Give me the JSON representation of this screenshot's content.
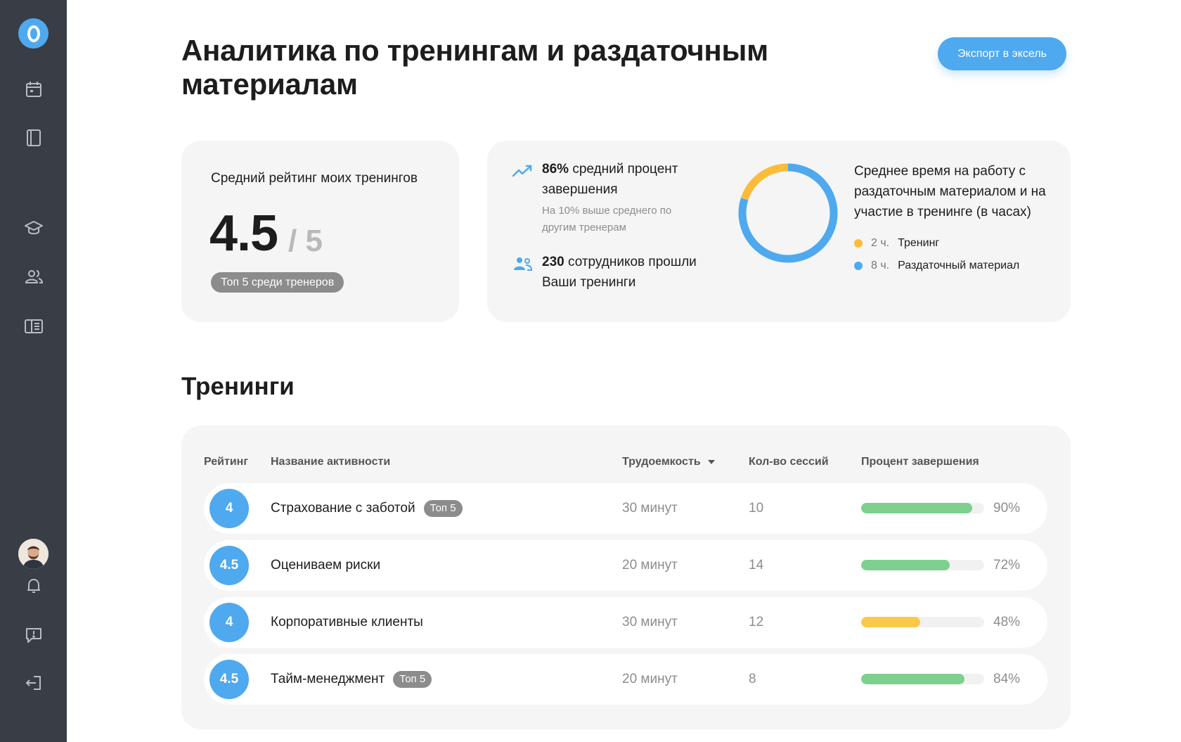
{
  "header": {
    "title": "Аналитика по тренингам и раздаточным материалам",
    "export_label": "Экспорт в эксель"
  },
  "rating_card": {
    "label": "Средний рейтинг моих тренингов",
    "value": "4.5",
    "max": "/ 5",
    "badge": "Топ 5 среди тренеров"
  },
  "completion_stat": {
    "value": "86%",
    "text": "средний процент завершения",
    "sub": "На 10% выше среднего по другим тренерам"
  },
  "employees_stat": {
    "value": "230",
    "text": "сотрудников прошли Ваши тренинги"
  },
  "time_chart": {
    "title": "Среднее время на работу с раздаточным материалом и на участие в тренинге (в часах)",
    "items": [
      {
        "value": "2 ч.",
        "label": "Тренинг",
        "hours": 2,
        "color": "#fbbc3c"
      },
      {
        "value": "8 ч.",
        "label": "Раздаточный материал",
        "hours": 8,
        "color": "#4ea9ef"
      }
    ]
  },
  "trainings": {
    "title": "Тренинги",
    "columns": {
      "rating": "Рейтинг",
      "name": "Название активности",
      "effort": "Трудоемкость",
      "sessions": "Кол-во сессий",
      "completion": "Процент завершения"
    },
    "rows": [
      {
        "rating": "4",
        "name": "Страхование с заботой",
        "badge": "Топ 5",
        "effort": "30 минут",
        "sessions": "10",
        "percent_label": "90%",
        "percent": 90,
        "color": "#7fcf8f"
      },
      {
        "rating": "4.5",
        "name": "Оцениваем риски",
        "badge": "",
        "effort": "20 минут",
        "sessions": "14",
        "percent_label": "72%",
        "percent": 72,
        "color": "#7fcf8f"
      },
      {
        "rating": "4",
        "name": "Корпоративные клиенты",
        "badge": "",
        "effort": "30 минут",
        "sessions": "12",
        "percent_label": "48%",
        "percent": 48,
        "color": "#fbc94a"
      },
      {
        "rating": "4.5",
        "name": "Тайм-менеджмент",
        "badge": "Топ 5",
        "effort": "20 минут",
        "sessions": "8",
        "percent_label": "84%",
        "percent": 84,
        "color": "#7fcf8f"
      }
    ]
  },
  "sidebar": {
    "icons": [
      "logo-icon",
      "calendar-icon",
      "book-icon",
      "graduation-cap-icon",
      "users-icon",
      "catalog-icon",
      "avatar",
      "bell-icon",
      "feedback-icon",
      "logout-icon"
    ]
  }
}
